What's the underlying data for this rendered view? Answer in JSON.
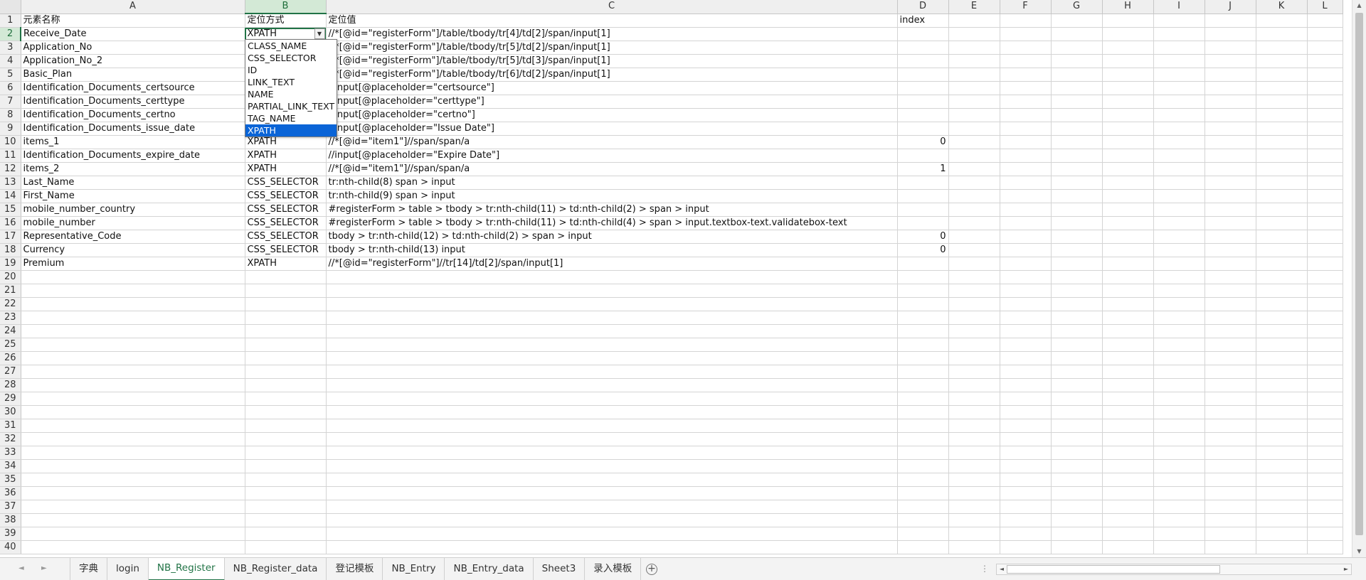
{
  "columns": [
    "A",
    "B",
    "C",
    "D",
    "E",
    "F",
    "G",
    "H",
    "I",
    "J",
    "K",
    "L"
  ],
  "row_numbers": [
    "1",
    "2",
    "3",
    "4",
    "5",
    "6",
    "7",
    "8",
    "9",
    "10",
    "11",
    "12",
    "13",
    "14",
    "15",
    "16",
    "17",
    "18",
    "19",
    "20",
    "21",
    "22",
    "23",
    "24",
    "25",
    "26",
    "27",
    "28",
    "29",
    "30",
    "31",
    "32",
    "33",
    "34",
    "35",
    "36",
    "37",
    "38",
    "39",
    "40"
  ],
  "rows": [
    [
      "元素名称",
      "定位方式",
      "定位值",
      "index"
    ],
    [
      "Receive_Date",
      "XPATH",
      "//*[@id=\"registerForm\"]/table/tbody/tr[4]/td[2]/span/input[1]",
      ""
    ],
    [
      "Application_No",
      "",
      "//*[@id=\"registerForm\"]/table/tbody/tr[5]/td[2]/span/input[1]",
      ""
    ],
    [
      "Application_No_2",
      "",
      "//*[@id=\"registerForm\"]/table/tbody/tr[5]/td[3]/span/input[1]",
      ""
    ],
    [
      "Basic_Plan",
      "",
      "//*[@id=\"registerForm\"]/table/tbody/tr[6]/td[2]/span/input[1]",
      ""
    ],
    [
      "Identification_Documents_certsource",
      "",
      "//input[@placeholder=\"certsource\"]",
      ""
    ],
    [
      "Identification_Documents_certtype",
      "",
      "//input[@placeholder=\"certtype\"]",
      ""
    ],
    [
      "Identification_Documents_certno",
      "",
      "//input[@placeholder=\"certno\"]",
      ""
    ],
    [
      "Identification_Documents_issue_date",
      "",
      "//input[@placeholder=\"Issue Date\"]",
      ""
    ],
    [
      "items_1",
      "XPATH",
      "//*[@id=\"item1\"]//span/span/a",
      "0"
    ],
    [
      "Identification_Documents_expire_date",
      "XPATH",
      "//input[@placeholder=\"Expire Date\"]",
      ""
    ],
    [
      "items_2",
      "XPATH",
      "//*[@id=\"item1\"]//span/span/a",
      "1"
    ],
    [
      "Last_Name",
      "CSS_SELECTOR",
      "tr:nth-child(8)  span > input",
      ""
    ],
    [
      "First_Name",
      "CSS_SELECTOR",
      "tr:nth-child(9)  span > input",
      ""
    ],
    [
      "mobile_number_country",
      "CSS_SELECTOR",
      "#registerForm > table > tbody > tr:nth-child(11) > td:nth-child(2) > span > input",
      ""
    ],
    [
      "mobile_number",
      "CSS_SELECTOR",
      "#registerForm > table > tbody > tr:nth-child(11) > td:nth-child(4) > span > input.textbox-text.validatebox-text",
      ""
    ],
    [
      "Representative_Code",
      "CSS_SELECTOR",
      "tbody > tr:nth-child(12) > td:nth-child(2) > span > input",
      "0"
    ],
    [
      "Currency",
      "CSS_SELECTOR",
      "tbody > tr:nth-child(13) input",
      "0"
    ],
    [
      "Premium",
      "XPATH",
      "//*[@id=\"registerForm\"]//tr[14]/td[2]/span/input[1]",
      ""
    ]
  ],
  "dropdown": {
    "options": [
      "CLASS_NAME",
      "CSS_SELECTOR",
      "ID",
      "LINK_TEXT",
      "NAME",
      "PARTIAL_LINK_TEXT",
      "TAG_NAME",
      "XPATH"
    ],
    "selected": "XPATH"
  },
  "tabs": [
    "字典",
    "login",
    "NB_Register",
    "NB_Register_data",
    "登记模板",
    "NB_Entry",
    "NB_Entry_data",
    "Sheet3",
    "录入模板"
  ],
  "active_tab": "NB_Register",
  "tabnav": {
    "prev": "◄",
    "next": "►"
  },
  "add_sheet_label": "+",
  "ellipsis": "⋮",
  "scroll_arrows": {
    "up": "▲",
    "down": "▼",
    "left": "◄",
    "right": "►",
    "dropdown": "▼"
  },
  "colors": {
    "accent": "#217346",
    "selected_option": "#0a64d7",
    "header_bg": "#efefef"
  }
}
